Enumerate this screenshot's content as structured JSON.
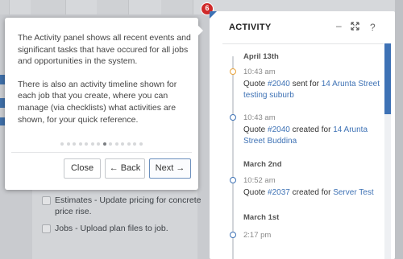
{
  "tour": {
    "step_number": "6",
    "paragraph1": "The Activity panel shows all recent events and significant tasks that have occured for all jobs and opportunities in the system.",
    "paragraph2": "There is also an activity timeline shown for each job that you create, where you can manage (via checklists) what activities are shown, for your quick reference.",
    "dots_total": 14,
    "dots_active_index": 7,
    "close_label": "Close",
    "back_label": "← Back",
    "next_label": "Next →"
  },
  "background": {
    "task1": "Estimates - Update pricing for concrete",
    "task1_cont": "price rise.",
    "task2": "Jobs - Upload plan files to job."
  },
  "activity_panel": {
    "title": "ACTIVITY",
    "minimize_icon": "minimize-icon",
    "expand_icon": "expand-icon",
    "help_icon": "help-icon",
    "groups": [
      {
        "date": "April 13th",
        "entries": [
          {
            "time": "10:43 am",
            "prefix": "Quote ",
            "quote": "#2040",
            "middle": " sent for ",
            "target": "14 Arunta Street testing suburb",
            "dot_color": "#e8a23a"
          },
          {
            "time": "10:43 am",
            "prefix": "Quote ",
            "quote": "#2040",
            "middle": " created for ",
            "target": "14 Arunta Street Buddina",
            "dot_color": "#3e72b5"
          }
        ]
      },
      {
        "date": "March 2nd",
        "entries": [
          {
            "time": "10:52 am",
            "prefix": "Quote ",
            "quote": "#2037",
            "middle": " created for ",
            "target": "Server Test",
            "dot_color": "#3e72b5"
          }
        ]
      },
      {
        "date": "March 1st",
        "entries": [
          {
            "time": "2:17 pm",
            "dot_color": "#3e72b5"
          }
        ]
      }
    ],
    "accent_color": "#3e72b5"
  }
}
